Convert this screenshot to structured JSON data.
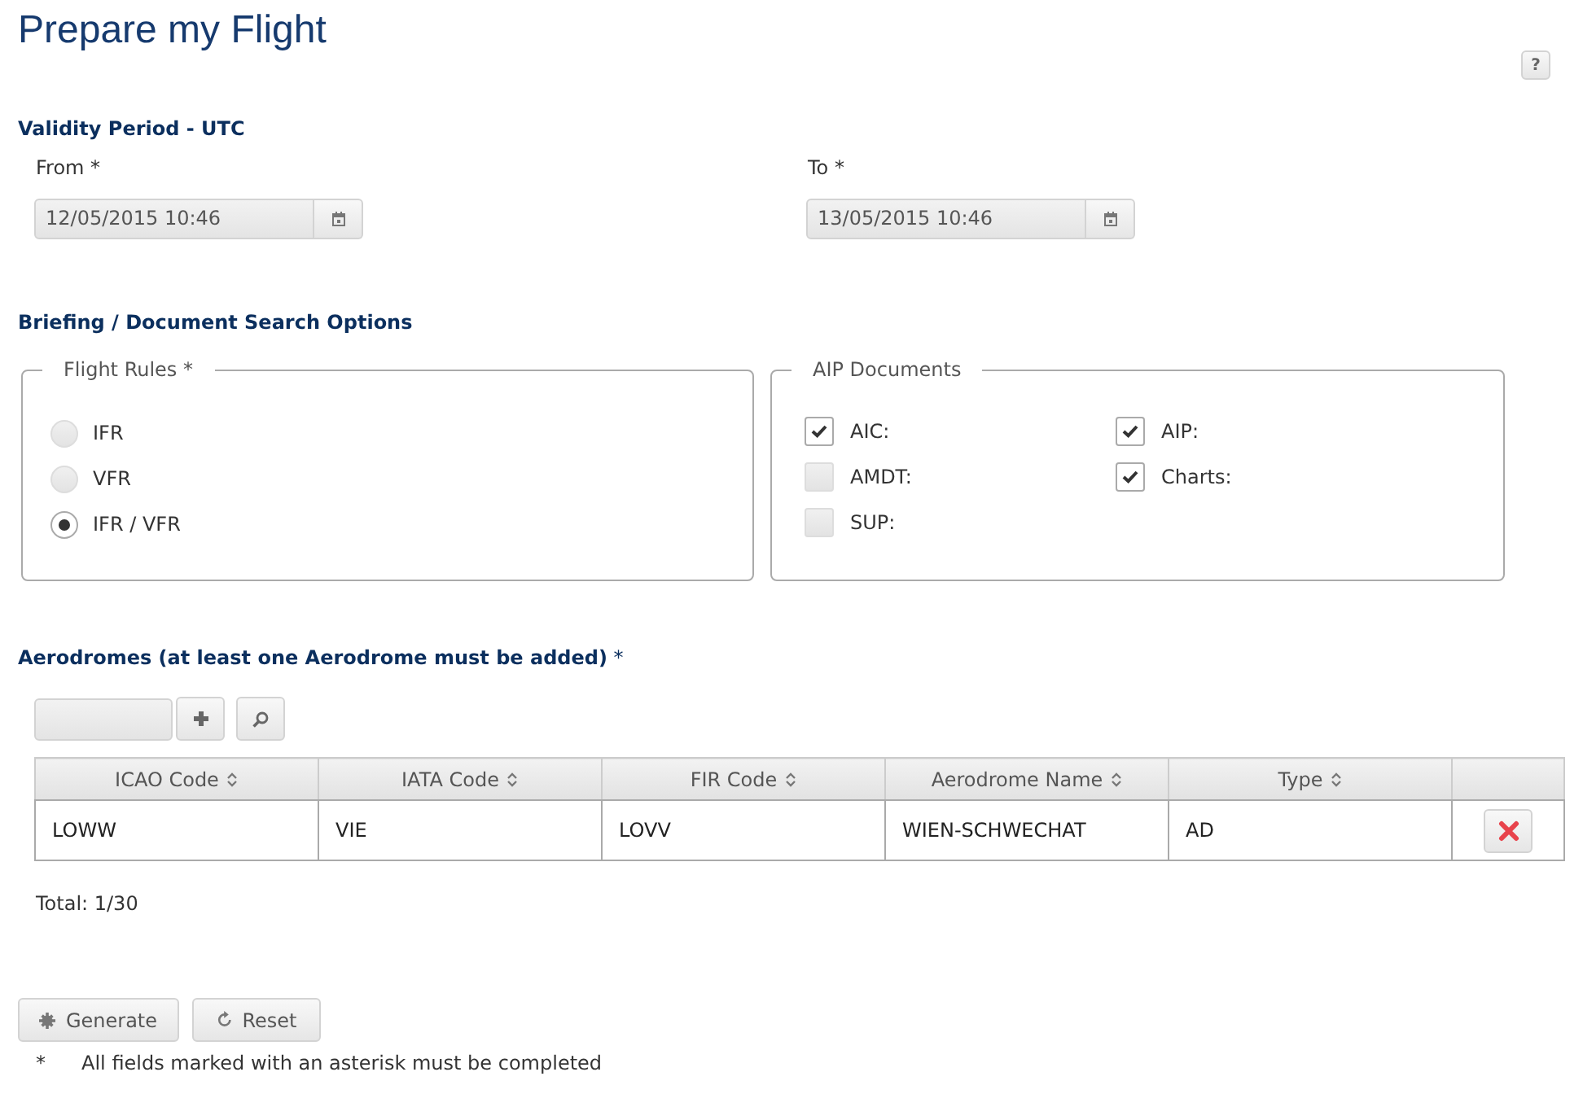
{
  "page": {
    "title": "Prepare my Flight",
    "help_button": "?"
  },
  "validity_period": {
    "heading": "Validity Period - UTC",
    "fields": [
      {
        "label": "From *",
        "value": "12/05/2015 10:46"
      },
      {
        "label": "To *",
        "value": "13/05/2015 10:46"
      }
    ]
  },
  "search_options": {
    "heading": "Briefing / Document Search Options",
    "flight_rules": {
      "legend": "Flight Rules *",
      "options": [
        {
          "label": "IFR",
          "selected": false
        },
        {
          "label": "VFR",
          "selected": false
        },
        {
          "label": "IFR / VFR",
          "selected": true
        }
      ]
    },
    "aip_documents": {
      "legend": "AIP Documents",
      "items": [
        {
          "label": "AIC:",
          "checked": true
        },
        {
          "label": "AMDT:",
          "checked": false
        },
        {
          "label": "SUP:",
          "checked": false
        },
        {
          "label": "AIP:",
          "checked": true
        },
        {
          "label": "Charts:",
          "checked": true
        }
      ]
    }
  },
  "aerodromes": {
    "heading": "**Aerodromes (at least one Aerodrome must be added)** *",
    "table": {
      "columns": [
        "ICAO Code",
        "IATA Code",
        "FIR Code",
        "Aerodrome Name",
        "Type"
      ],
      "rows": [
        {
          "cells": [
            "LOWW",
            "VIE",
            "LOVV",
            "WIEN-SCHWECHAT",
            "AD"
          ]
        }
      ]
    },
    "total": "Total: 1/30"
  },
  "actions": {
    "generate": "Generate",
    "reset": "Reset"
  },
  "footnote": {
    "mark": "*",
    "text": "All fields marked with an asterisk must be completed"
  }
}
